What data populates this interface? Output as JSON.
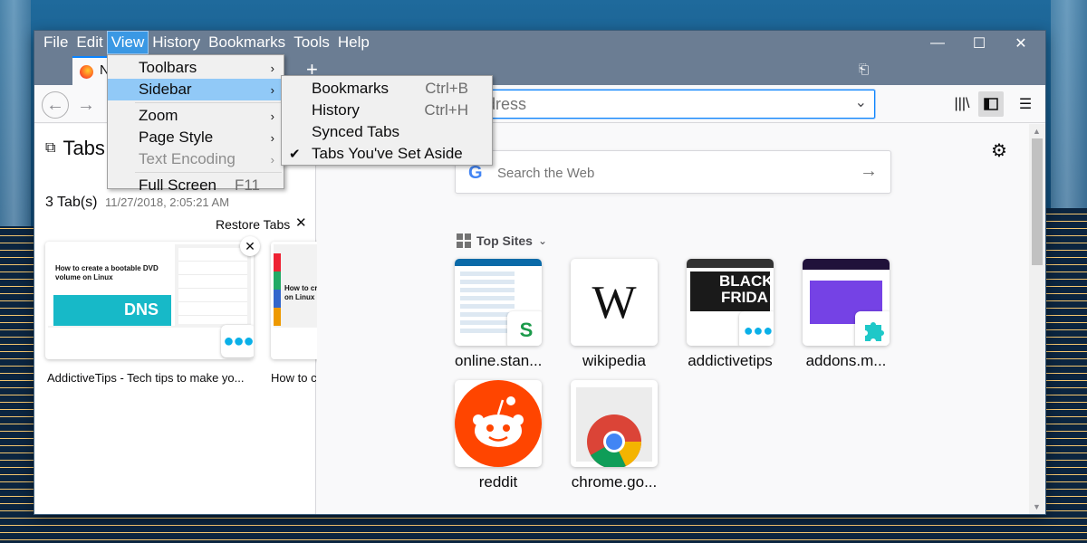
{
  "menubar": [
    "File",
    "Edit",
    "View",
    "History",
    "Bookmarks",
    "Tools",
    "Help"
  ],
  "active_menu_index": 2,
  "window_controls": {
    "minimize": "—",
    "maximize": "☐",
    "close": "✕"
  },
  "tab": {
    "title": "N",
    "new_tab": "+"
  },
  "url": {
    "placeholder": "address"
  },
  "view_menu": [
    {
      "label": "Toolbars",
      "submenu": true
    },
    {
      "label": "Sidebar",
      "submenu": true,
      "selected": true
    },
    {
      "label": "Zoom",
      "submenu": true
    },
    {
      "label": "Page Style",
      "submenu": true
    },
    {
      "label": "Text Encoding",
      "submenu": true,
      "disabled": true
    },
    {
      "label": "Full Screen",
      "accel": "F11"
    }
  ],
  "sidebar_menu": [
    {
      "label": "Bookmarks",
      "accel": "Ctrl+B"
    },
    {
      "label": "History",
      "accel": "Ctrl+H"
    },
    {
      "label": "Synced Tabs",
      "accel": ""
    },
    {
      "label": "Tabs You've Set Aside",
      "accel": "",
      "checked": true
    }
  ],
  "sidebar": {
    "title": "Tabs",
    "count": "3 Tab(s)",
    "timestamp": "11/27/2018, 2:05:21 AM",
    "restore": "Restore Tabs",
    "cards": [
      {
        "title": "AddictiveTips - Tech tips to make yo...",
        "headline": "How to create a bootable DVD volume on Linux",
        "tag": "DNS"
      },
      {
        "title": "How to c",
        "headline": "How to cre on Linux",
        "tag": ""
      }
    ]
  },
  "newtab": {
    "search_placeholder": "Search the Web",
    "top_sites_label": "Top Sites",
    "sites": [
      {
        "label": "online.stan..."
      },
      {
        "label": "wikipedia",
        "glyph": "W"
      },
      {
        "label": "addictivetips",
        "banner": "BLACK FRIDA"
      },
      {
        "label": "addons.m..."
      },
      {
        "label": "reddit"
      },
      {
        "label": "chrome.go..."
      }
    ]
  },
  "colors": {
    "accent": "#0a84ff",
    "menu_highlight": "#91c9f7",
    "titlebar": "#6b7d93",
    "reddit": "#ff4500"
  }
}
